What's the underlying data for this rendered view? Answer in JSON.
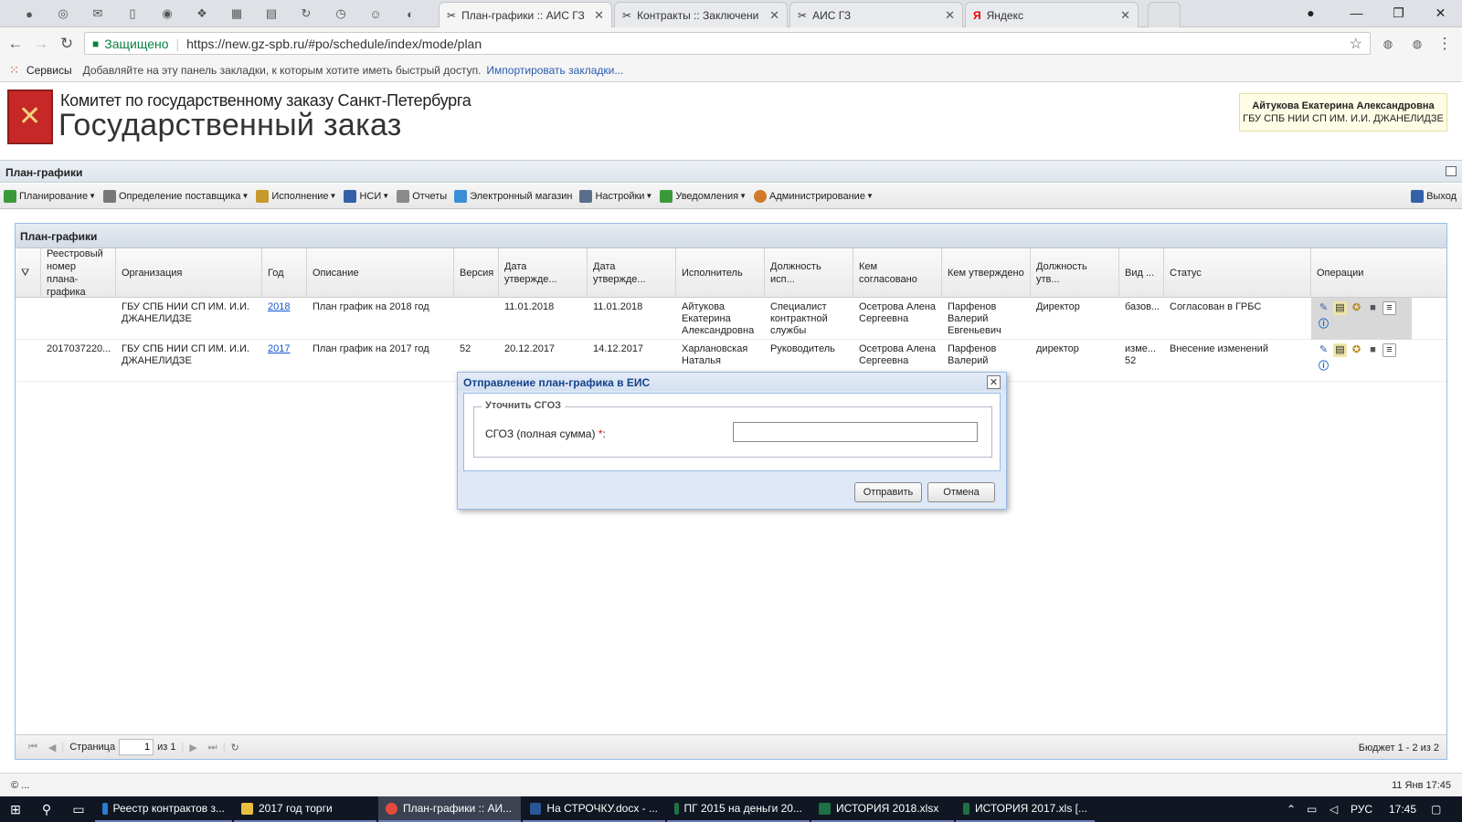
{
  "browser": {
    "pinned_icons": [
      "twitter-icon",
      "browser-icon",
      "mail-icon",
      "page-icon",
      "shield-icon",
      "money-icon",
      "calculator-icon",
      "doc-icon",
      "refresh-icon",
      "clock-icon",
      "people-icon",
      "circle-icon"
    ],
    "tabs": [
      {
        "title": "План-графики :: АИС ГЗ",
        "active": true
      },
      {
        "title": "Контракты :: Заключени",
        "active": false
      },
      {
        "title": "АИС ГЗ",
        "active": false
      },
      {
        "title": "Яндекс",
        "active": false
      }
    ],
    "secure_label": "Защищено",
    "url": "https://new.gz-spb.ru/#po/schedule/index/mode/plan",
    "bookmarks": {
      "apps_label": "Сервисы",
      "hint": "Добавляйте на эту панель закладки, к которым хотите иметь быстрый доступ.",
      "import_link": "Импортировать закладки..."
    }
  },
  "site": {
    "title_line1": "Комитет по государственному заказу Санкт-Петербурга",
    "title_line2": "Государственный заказ",
    "user_name": "Айтукова Екатерина Александровна",
    "user_org": "ГБУ СПБ НИИ СП ИМ. И.И. ДЖАНЕЛИДЗЕ"
  },
  "app": {
    "page_title": "План-графики",
    "menu": [
      {
        "label": "Планирование",
        "dropdown": true,
        "color": "#3a9a3a"
      },
      {
        "label": "Определение поставщика",
        "dropdown": true,
        "color": "#777777"
      },
      {
        "label": "Исполнение",
        "dropdown": true,
        "color": "#c59a2a"
      },
      {
        "label": "НСИ",
        "dropdown": true,
        "color": "#3460a8"
      },
      {
        "label": "Отчеты",
        "dropdown": false,
        "color": "#8a8a8a"
      },
      {
        "label": "Электронный магазин",
        "dropdown": false,
        "color": "#3b8fd6"
      },
      {
        "label": "Настройки",
        "dropdown": true,
        "color": "#5a6e8a"
      },
      {
        "label": "Уведомления",
        "dropdown": true,
        "color": "#3a9a3a"
      },
      {
        "label": "Администрирование",
        "dropdown": true,
        "color": "#d07a2a"
      }
    ],
    "exit_label": "Выход"
  },
  "grid": {
    "title": "План-графики",
    "columns": [
      "",
      "Реестровый номер плана-графика",
      "Организация",
      "Год",
      "Описание",
      "Версия",
      "Дата утвержде...",
      "Дата утвержде...",
      "Исполнитель",
      "Должность исп...",
      "Кем согласовано",
      "Кем утверждено",
      "Должность утв...",
      "Вид ...",
      "Статус",
      "Операции"
    ],
    "rows": [
      {
        "reg_number": "",
        "org": "ГБУ СПБ НИИ СП ИМ. И.И. ДЖАНЕЛИДЗЕ",
        "year": "2018",
        "description": "План график на 2018 год",
        "version": "",
        "date1": "11.01.2018",
        "date2": "11.01.2018",
        "executor": "Айтукова Екатерина Александровна",
        "executor_position": "Специалист контрактной службы",
        "agreed_by": "Осетрова Алена Сергеевна",
        "approved_by": "Парфенов Валерий Евгеньевич",
        "approver_position": "Директор",
        "kind": "базов...",
        "status": "Согласован в ГРБС"
      },
      {
        "reg_number": "2017037220...",
        "org": "ГБУ СПБ НИИ СП ИМ. И.И. ДЖАНЕЛИДЗЕ",
        "year": "2017",
        "description": "План график на 2017 год",
        "version": "52",
        "date1": "20.12.2017",
        "date2": "14.12.2017",
        "executor": "Харлановская Наталья",
        "executor_position": "Руководитель",
        "agreed_by": "Осетрова Алена Сергеевна",
        "approved_by": "Парфенов Валерий",
        "approver_position": "директор",
        "kind": "изме... 52",
        "status": "Внесение изменений"
      }
    ],
    "operation_icons": [
      "edit-icon",
      "document-icon",
      "emblem-icon",
      "lock-icon",
      "page-icon",
      "info-icon"
    ],
    "pager": {
      "page_label": "Страница",
      "page_value": "1",
      "of_label": "из 1",
      "info": "Бюджет 1 - 2 из 2"
    }
  },
  "status_bar": {
    "left": "© ...",
    "right": "11 Янв 17:45"
  },
  "dialog": {
    "title": "Отправление план-графика в ЕИС",
    "fieldset_legend": "Уточнить СГОЗ",
    "field_label": "СГОЗ (полная сумма)",
    "required_mark": "*",
    "field_suffix": ":",
    "field_value": "",
    "send_label": "Отправить",
    "cancel_label": "Отмена"
  },
  "taskbar": {
    "items": [
      {
        "label": "Реестр контрактов з...",
        "color": "#2b7cd3",
        "active": false
      },
      {
        "label": "2017 год торги",
        "color": "#e8c040",
        "active": false
      },
      {
        "label": "План-графики :: АИ...",
        "color": "#e54b3c",
        "active": true
      },
      {
        "label": "На СТРОЧКУ.docx - ...",
        "color": "#2b5797",
        "active": false
      },
      {
        "label": "ПГ 2015 на деньги 20...",
        "color": "#1e7145",
        "active": false
      },
      {
        "label": "ИСТОРИЯ 2018.xlsx",
        "color": "#1e7145",
        "active": false
      },
      {
        "label": "ИСТОРИЯ 2017.xls [...",
        "color": "#1e7145",
        "active": false
      }
    ],
    "lang": "РУС",
    "time": "17:45"
  }
}
